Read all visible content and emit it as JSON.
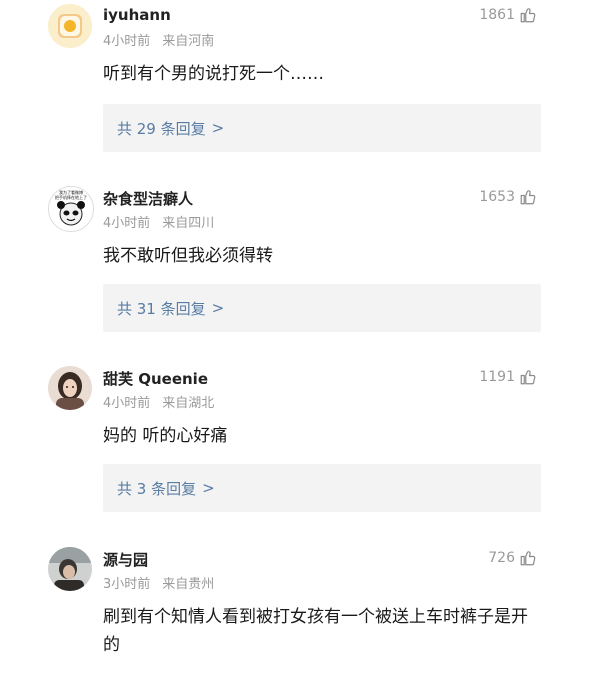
{
  "comments": [
    {
      "username": "iyuhann",
      "time": "4小时前",
      "location": "来自河南",
      "likes": "1861",
      "content": "听到有个男的说打死一个……",
      "replies": "共 29 条回复",
      "avatar": "toast-egg-avatar"
    },
    {
      "username": "杂食型洁癖人",
      "time": "4小时前",
      "location": "来自四川",
      "likes": "1653",
      "content": "我不敢听但我必须得转",
      "replies": "共 31 条回复",
      "avatar": "panda-meme-avatar",
      "avatar_text": "我为了看微博\n把手机摔在地上了"
    },
    {
      "username": "甜芙 Queenie",
      "time": "4小时前",
      "location": "来自湖北",
      "likes": "1191",
      "content": "妈的 听的心好痛",
      "replies": "共 3 条回复",
      "avatar": "girl-photo-avatar"
    },
    {
      "username": "源与园",
      "time": "3小时前",
      "location": "来自贵州",
      "likes": "726",
      "content": "刷到有个知情人看到被打女孩有一个被送上车时裤子是开的",
      "avatar": "person-photo-avatar"
    }
  ],
  "icons": {
    "like": "thumbs-up-icon",
    "chevron": ">"
  },
  "colors": {
    "reply_link": "#587ca3",
    "meta": "#9a9a9a",
    "reply_bg": "#f3f3f3"
  }
}
